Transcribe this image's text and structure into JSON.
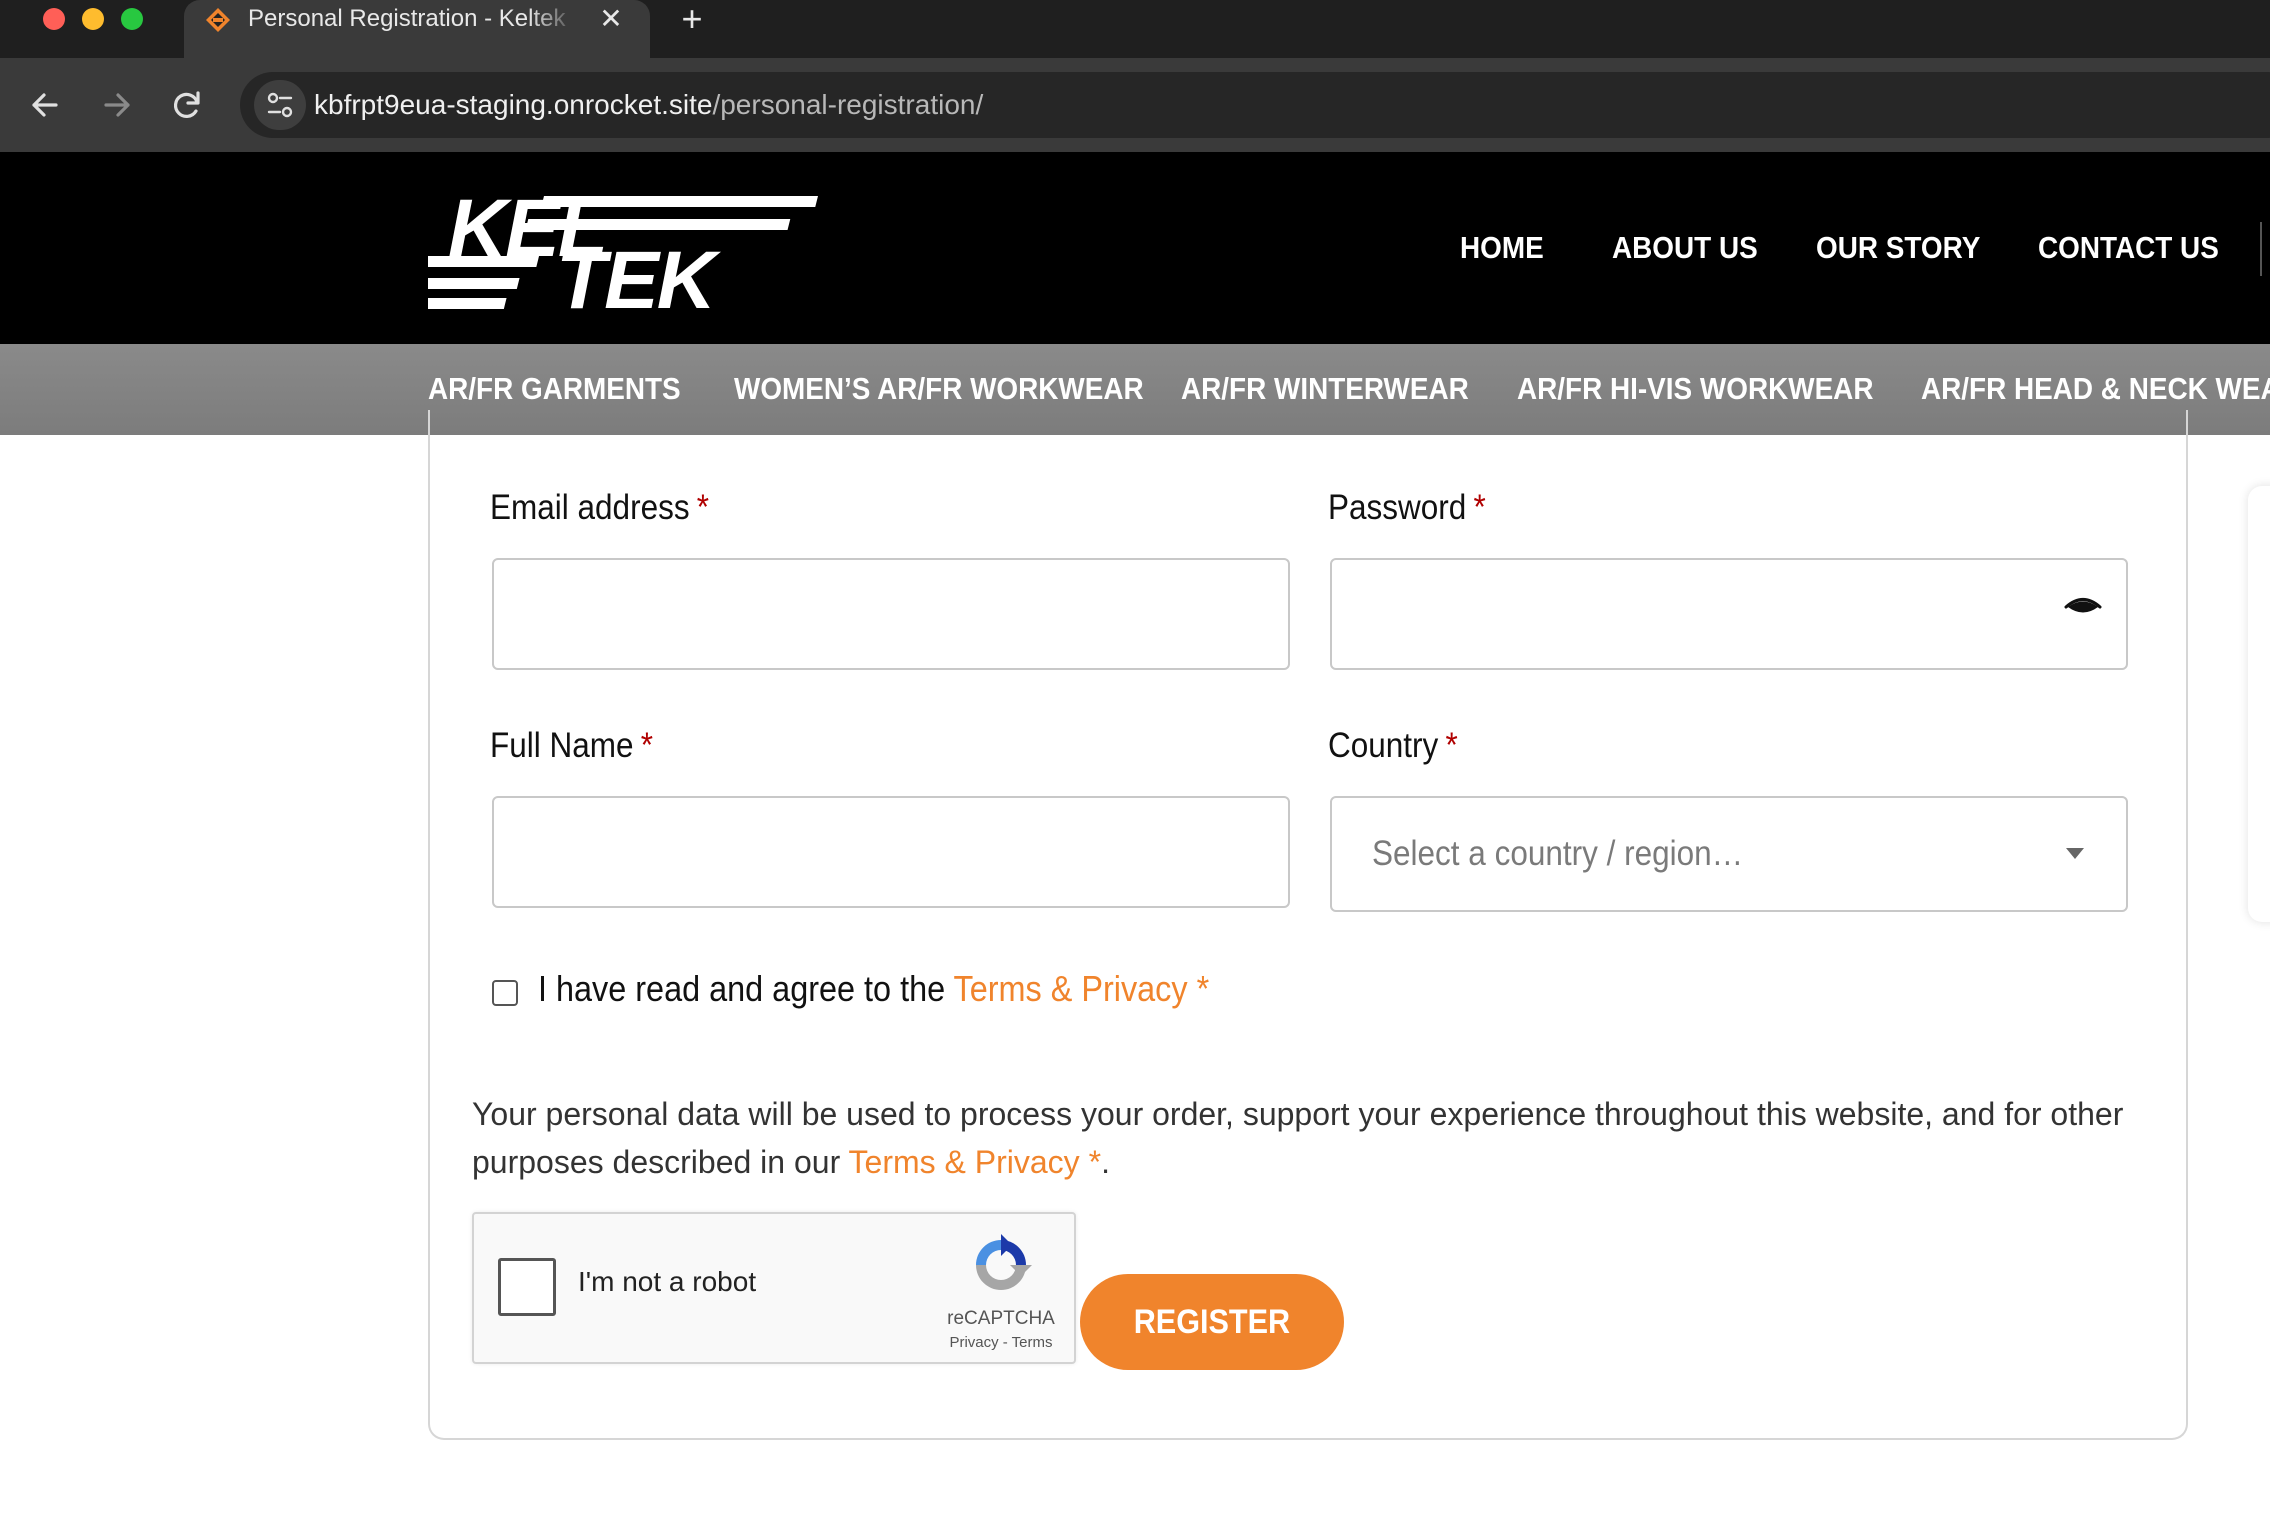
{
  "browser": {
    "tab_title": "Personal Registration - Keltek",
    "tab_close_glyph": "✕",
    "new_tab_glyph": "+",
    "url_host": "kbfrpt9eua-staging.onrocket.site",
    "url_path": "/personal-registration/"
  },
  "site": {
    "logo_line1": "KEL",
    "logo_line2": "TEK",
    "main_nav": [
      "HOME",
      "ABOUT US",
      "OUR STORY",
      "CONTACT US"
    ],
    "category_nav": [
      "AR/FR GARMENTS",
      "WOMEN’S AR/FR WORKWEAR",
      "AR/FR WINTERWEAR",
      "AR/FR HI-VIS WORKWEAR",
      "AR/FR HEAD & NECK WEAR"
    ]
  },
  "form": {
    "email_label": "Email address",
    "email_value": "",
    "password_label": "Password",
    "password_value": "",
    "fullname_label": "Full Name",
    "fullname_value": "",
    "country_label": "Country",
    "country_placeholder": "Select a country / region…",
    "required_mark": "*",
    "agree_prefix": "I have read and agree to the",
    "terms_link": "Terms & Privacy",
    "privacy_text": "Your personal data will be used to process your order, support your experience throughout this website, and for other purposes described in our",
    "privacy_link": "Terms & Privacy",
    "privacy_end": ".",
    "recaptcha_label": "I'm not a robot",
    "recaptcha_brand": "reCAPTCHA",
    "recaptcha_links": "Privacy - Terms",
    "register_label": "REGISTER"
  },
  "colors": {
    "accent": "#f0842c",
    "required": "#b00000",
    "header_bg": "#000000",
    "category_bar_bg": "#808080"
  },
  "icons": [
    "back-arrow-icon",
    "forward-arrow-icon",
    "reload-icon",
    "site-info-icon",
    "eye-icon",
    "dropdown-caret-icon",
    "recaptcha-logo-icon"
  ]
}
